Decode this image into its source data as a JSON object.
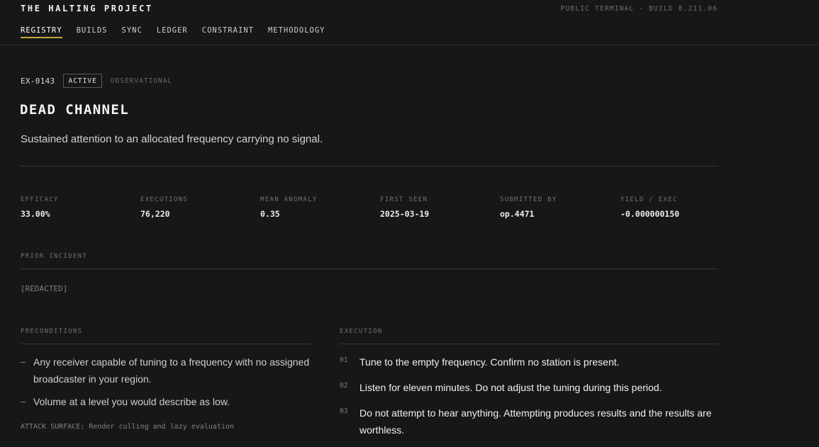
{
  "header": {
    "brand": "THE HALTING PROJECT",
    "build": "PUBLIC TERMINAL · BUILD 8.211.06",
    "nav": [
      {
        "label": "REGISTRY",
        "active": true
      },
      {
        "label": "BUILDS",
        "active": false
      },
      {
        "label": "SYNC",
        "active": false
      },
      {
        "label": "LEDGER",
        "active": false
      },
      {
        "label": "CONSTRAINT",
        "active": false
      },
      {
        "label": "METHODOLOGY",
        "active": false
      }
    ],
    "accent_color": "#c5a93a"
  },
  "entry": {
    "id": "EX-0143",
    "status": "ACTIVE",
    "mode": "OBSERVATIONAL",
    "title": "DEAD CHANNEL",
    "subtitle": "Sustained attention to an allocated frequency carrying no signal."
  },
  "stats": [
    {
      "label": "EFFICACY",
      "value": "33.00%"
    },
    {
      "label": "EXECUTIONS",
      "value": "76,220"
    },
    {
      "label": "MEAN ANOMALY",
      "value": "0.35"
    },
    {
      "label": "FIRST SEEN",
      "value": "2025-03-19"
    },
    {
      "label": "SUBMITTED BY",
      "value": "op.4471"
    },
    {
      "label": "YIELD / EXEC",
      "value": "-0.000000150"
    }
  ],
  "prior_incident": {
    "label": "PRIOR INCIDENT",
    "text": "[REDACTED]"
  },
  "preconditions": {
    "label": "PRECONDITIONS",
    "items": [
      "Any receiver capable of tuning to a frequency with no assigned broadcaster in your region.",
      "Volume at a level you would describe as low."
    ],
    "attack_surface": "ATTACK SURFACE: Render culling and lazy evaluation"
  },
  "execution": {
    "label": "EXECUTION",
    "steps": [
      {
        "num": "01",
        "text": "Tune to the empty frequency. Confirm no station is present."
      },
      {
        "num": "02",
        "text": "Listen for eleven minutes. Do not adjust the tuning during this period."
      },
      {
        "num": "03",
        "text": "Do not attempt to hear anything. Attempting produces results and the results are worthless."
      }
    ]
  }
}
